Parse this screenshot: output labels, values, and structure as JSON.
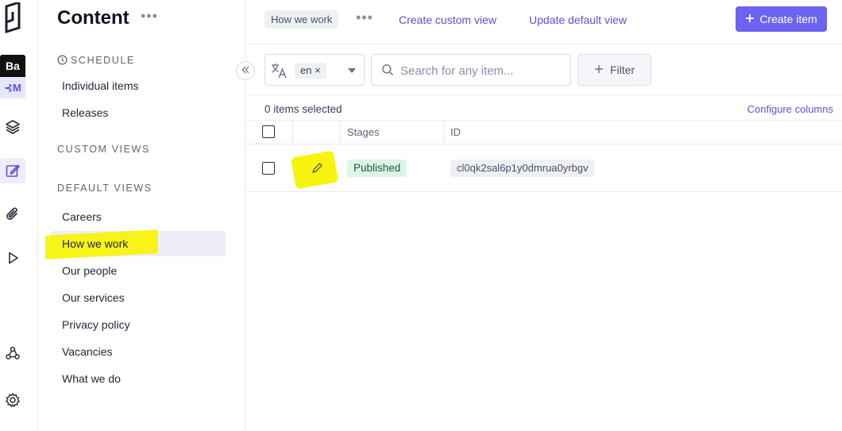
{
  "nav": {
    "title": "Content",
    "more": "•••",
    "schedule_heading": "SCHEDULE",
    "schedule_items": [
      {
        "label": "Individual items"
      },
      {
        "label": "Releases"
      }
    ],
    "custom_views_heading": "CUSTOM VIEWS",
    "default_views_heading": "DEFAULT VIEWS",
    "default_views": [
      {
        "label": "Careers"
      },
      {
        "label": "How we work",
        "selected": true
      },
      {
        "label": "Our people"
      },
      {
        "label": "Our services"
      },
      {
        "label": "Privacy policy"
      },
      {
        "label": "Vacancies"
      },
      {
        "label": "What we do"
      }
    ]
  },
  "rail": {
    "project_initials": "Ba",
    "project_sub": "⊰M",
    "icons": [
      "hygraph-logo-icon",
      "schema-layers-icon",
      "content-edit-icon",
      "assets-paperclip-icon",
      "playground-play-icon",
      "webhooks-icon",
      "settings-gear-icon"
    ]
  },
  "topbar": {
    "current_view": "How we work",
    "more": "•••",
    "create_custom_view": "Create custom view",
    "update_default_view": "Update default view",
    "create_item": "Create item"
  },
  "toolbar": {
    "locale": "en",
    "locale_remove": "×",
    "search_placeholder": "Search for any item...",
    "filter_label": "Filter"
  },
  "selection": {
    "count_text": "0 items selected",
    "configure_columns": "Configure columns"
  },
  "table": {
    "columns": [
      "Stages",
      "ID"
    ],
    "rows": [
      {
        "stage": "Published",
        "id": "cl0qk2sal6p1y0dmrua0yrbgv"
      }
    ]
  },
  "colors": {
    "accent": "#6c63f0",
    "link": "#5b52d6",
    "published_bg": "#ddf5e7",
    "annotation_highlight": "#f8f300"
  }
}
